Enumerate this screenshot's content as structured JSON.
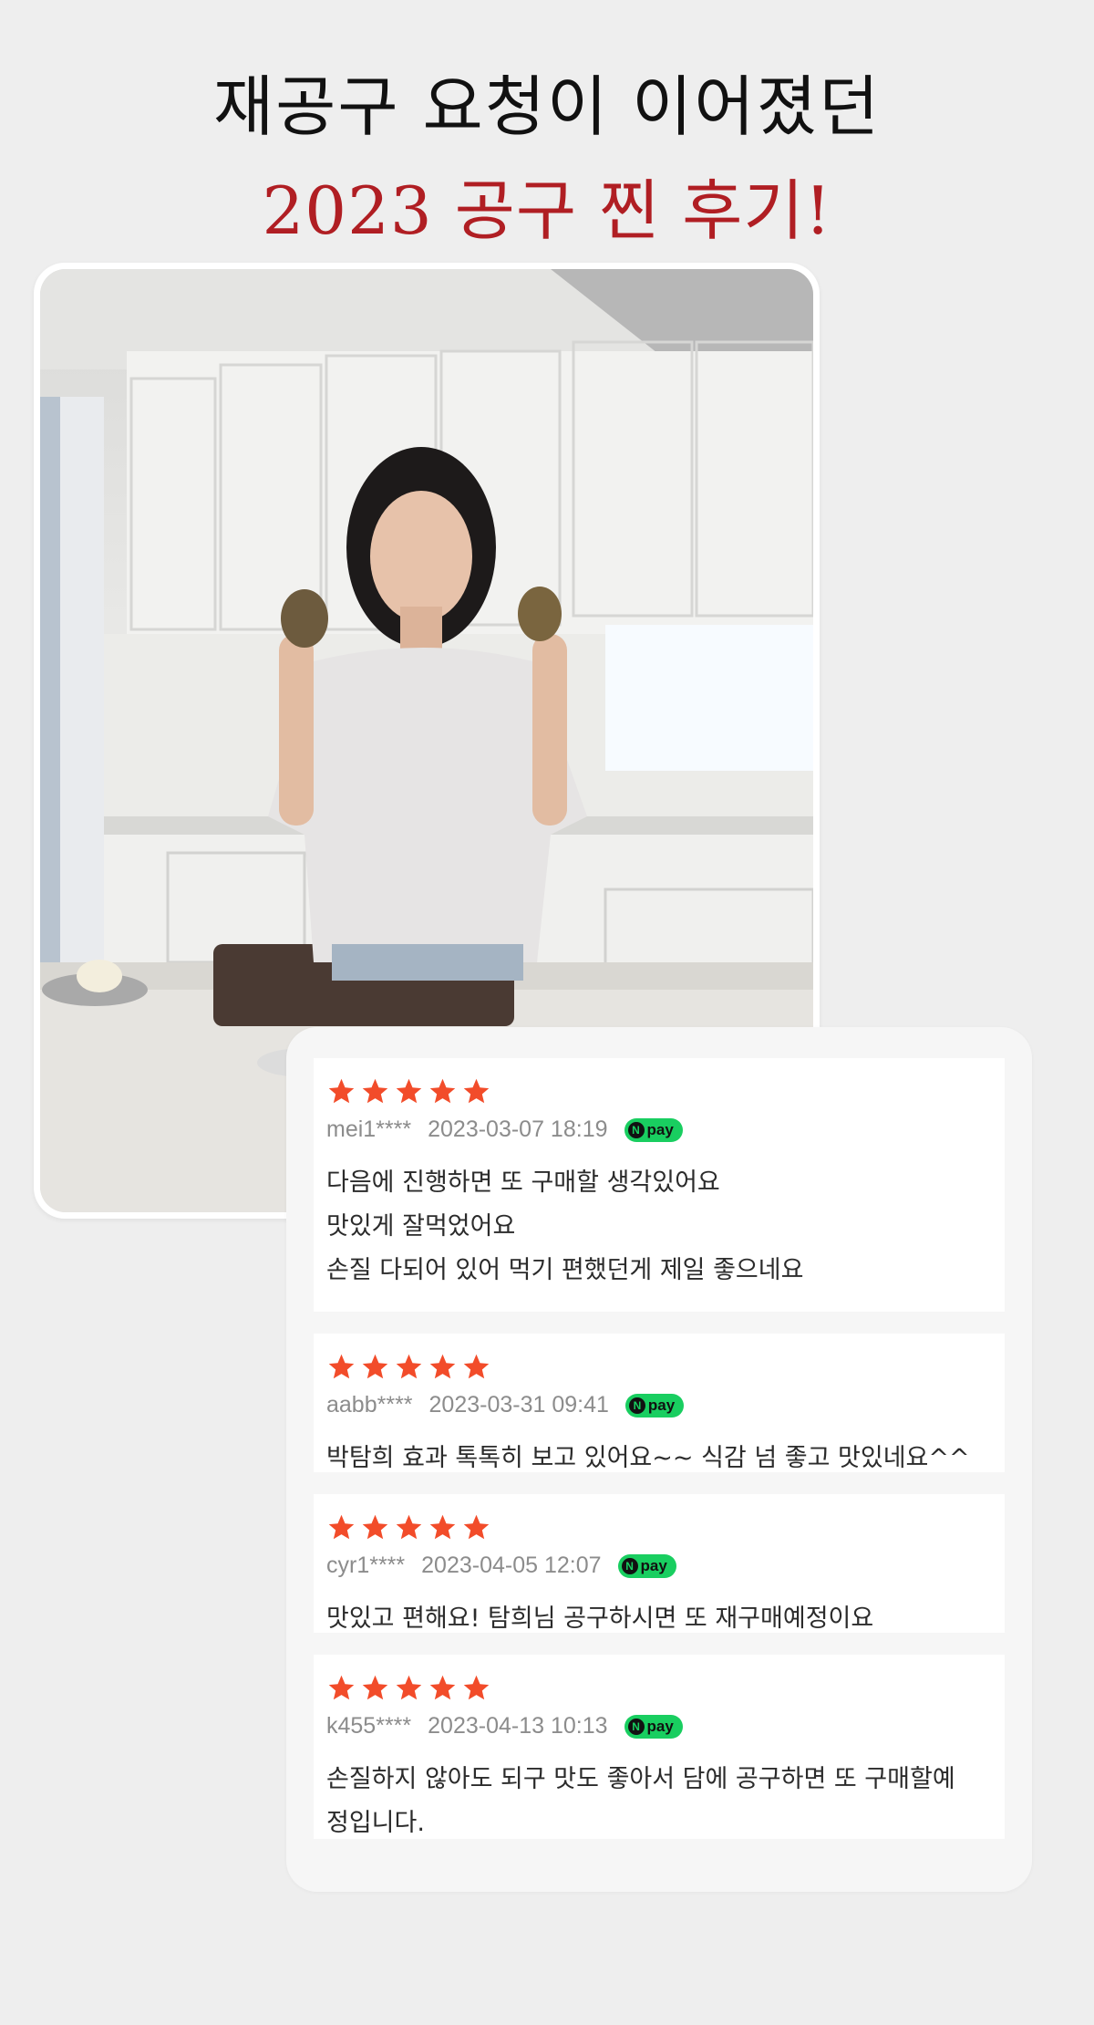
{
  "headline": {
    "line1": "재공구 요청이 이어졌던",
    "line2": "2023 공구 찐 후기!"
  },
  "colors": {
    "background": "#eeeeee",
    "accent_red": "#b01e23",
    "star": "#f24c2a",
    "npay_green": "#19ce60"
  },
  "photo": {
    "icon": "kitchen-photo"
  },
  "reviews": [
    {
      "stars": 5,
      "user": "mei1****",
      "date": "2023-03-07 18:19",
      "badge": "pay",
      "text": "다음에 진행하면 또 구매할 생각있어요\n맛있게 잘먹었어요\n손질 다되어 있어 먹기 편했던게 제일 좋으네요"
    },
    {
      "stars": 5,
      "user": "aabb****",
      "date": "2023-03-31 09:41",
      "badge": "pay",
      "text": "박탐희 효과 톡톡히 보고 있어요~~ 식감 넘 좋고 맛있네요^^"
    },
    {
      "stars": 5,
      "user": "cyr1****",
      "date": "2023-04-05 12:07",
      "badge": "pay",
      "text": "맛있고 편해요! 탐희님 공구하시면 또 재구매예정이요"
    },
    {
      "stars": 5,
      "user": "k455****",
      "date": "2023-04-13 10:13",
      "badge": "pay",
      "text": "손질하지 않아도 되구 맛도 좋아서 담에 공구하면 또 구매할예\n정입니다."
    }
  ]
}
